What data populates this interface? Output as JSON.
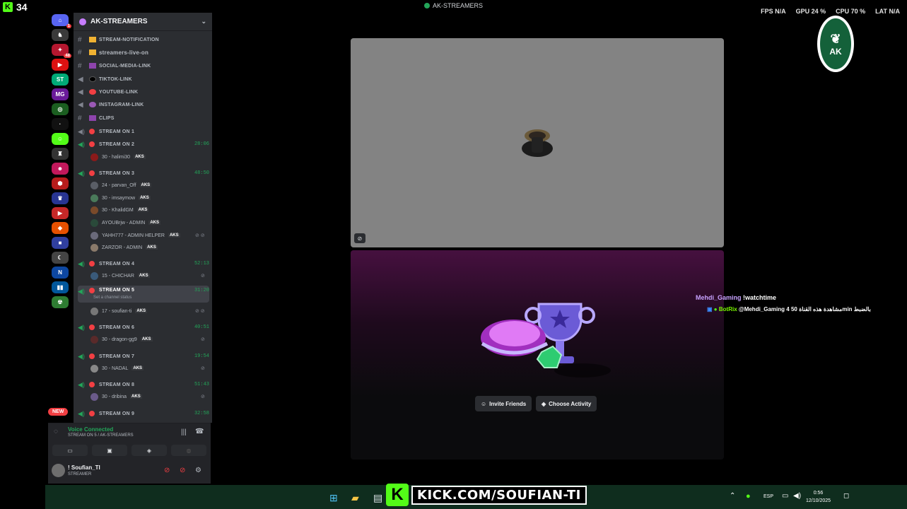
{
  "overlay": {
    "kick_count": "34",
    "kick_logo_letter": "K",
    "window_title": "AK-STREAMERS",
    "perf": {
      "fps": "FPS  N/A",
      "gpu": "GPU  24 %",
      "cpu": "CPU  70 %",
      "lat": "LAT  N/A"
    }
  },
  "rail": {
    "badges": {
      "home": "1",
      "server2": "48"
    },
    "new_pill": "NEW"
  },
  "server": {
    "name": "AK-STREAMERS"
  },
  "text_channels": [
    {
      "name": "stream-notification"
    },
    {
      "name": "streamers-live-on"
    },
    {
      "name": "social-media-link"
    },
    {
      "name": "tiktok-link"
    },
    {
      "name": "youtube-link"
    },
    {
      "name": "instagram-link"
    },
    {
      "name": "clips"
    }
  ],
  "voice_channels": [
    {
      "name": "STREAM ON 1",
      "time": ""
    },
    {
      "name": "STREAM ON 2",
      "time": "28:06"
    },
    {
      "name": "STREAM ON 3",
      "time": "48:50"
    },
    {
      "name": "STREAM ON 4",
      "time": "52:13"
    },
    {
      "name": "STREAM ON 5",
      "time": "31:20",
      "sub": "Set a channel status"
    },
    {
      "name": "STREAM ON 6",
      "time": "40:51"
    },
    {
      "name": "STREAM ON 7",
      "time": "19:54"
    },
    {
      "name": "STREAM ON 8",
      "time": "51:43"
    },
    {
      "name": "STREAM ON 9",
      "time": "32:58"
    }
  ],
  "voice_users": [
    {
      "name": "30 - halimi30",
      "tag": "AKS"
    },
    {
      "name": "24 - parvan_Off",
      "tag": "AKS"
    },
    {
      "name": "30 - imsaymow",
      "tag": "AKS"
    },
    {
      "name": "30 - KhalidGM",
      "tag": "AKS"
    },
    {
      "name": "AYOUBrjw - ADMIN",
      "tag": "AKS"
    },
    {
      "name": "YAHH777 - ADMIN HELPER",
      "tag": "AKS"
    },
    {
      "name": "ZARZOR - ADMIN",
      "tag": "AKS"
    },
    {
      "name": "15 - CHICHAR",
      "tag": "AKS"
    },
    {
      "name": "17 - soufian-ti",
      "tag": "AKS"
    },
    {
      "name": "30 - dragon-gg9",
      "tag": "AKS"
    },
    {
      "name": "30 - NADAL",
      "tag": "AKS"
    },
    {
      "name": "30 - dribina",
      "tag": "AKS"
    }
  ],
  "voice_panel": {
    "status": "Voice Connected",
    "channel": "STREAM ON 5 / AK-STREAMERS"
  },
  "user": {
    "name": "! Soufian_TI",
    "status": "STREAMER"
  },
  "activity": {
    "invite_label": "Invite Friends",
    "choose_label": "Choose Activity"
  },
  "chat": [
    {
      "user": "Mehdi_Gaming",
      "text": "!watchtime",
      "user_color": "#c8a2ff"
    },
    {
      "user": "BotRix",
      "text": "@Mehdi_Gaming 4 مشاهدة هذه القناة 50min بالضبط",
      "user_color": "#7CFC00"
    }
  ],
  "logo_text": "AK",
  "kick_banner": {
    "letter": "K",
    "url": "KICK.COM/SOUFIAN-TI"
  },
  "taskbar": {
    "lang": "ESP",
    "time": "0:56",
    "date": "12/10/2025"
  }
}
